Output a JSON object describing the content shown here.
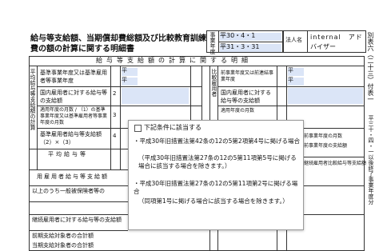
{
  "doc": {
    "title_line1": "給与等支給額、当期償却費総額及び比較教育訓練",
    "title_line2": "費の額の計算に関する明細書",
    "period_label": "事業年度",
    "date_from": "平30・4・1",
    "date_to": "平31・3・31",
    "corp_label": "法人名",
    "corp_name_line1": "internal　アド",
    "corp_name_line2": "バイザー",
    "side_form_label": "別表六（二十三）付表一",
    "side_period_label": "平三十・四・一以後終了事業年度分"
  },
  "form": {
    "section_header": "給与等支給額の計算に関する明細",
    "left_vertical_label": "平均給与等支給額の計算",
    "right_vertical_label": "比較雇用者",
    "row1_label": "基準事業年度又は基準雇用者等事業年度",
    "row1_era": "平",
    "row2_label": "国内雇用者に対する給与等の支給額",
    "row2_num": "2",
    "row3_label": "適用年度の月数 / （1）の基準事業年度又は基準雇用者等事業年度の月数",
    "row3_num": "3",
    "row4_label": "基準雇用者給与等支給額（2）×（3）",
    "row4_num": "4",
    "row5_label": "平均給与等",
    "section2_label": "用雇用者給与等支給額",
    "row7_label": "以上のうち一般被保険者等の",
    "row8_label": "継続雇用者に対する給与等の支給額",
    "row9_label": "前期支給対象者の合計額",
    "row10_label": "当期支給対象者の合計額",
    "right_period_label": "前事業年度又は前連結事業年度",
    "right_era": "平",
    "right_row1_label": "国内雇用者に対する給与等の支給額",
    "right_row2_label": "適用年度の月数",
    "right_row3_label": "前事業年度の月数",
    "right_row4_label": "前事業年度の支給額",
    "right_row5_label": "継続雇用者比較給与等支給額"
  },
  "popup": {
    "checkbox_label": "下記条件に該当する",
    "item1": "・平成30年旧措置法第42条の12の5第2項第4号に掲げる場合",
    "item1_note": "（平成30年旧措置法第27条の12の5第11項第5号に掲げる場合に該当する場合を除きます。）",
    "item2": "・平成30年旧措置法第27条の12の5第11項第2号に掲げる場合",
    "item2_note": "（同項第1号に掲げる場合に該当する場合を除きます。）",
    "checked": false
  }
}
